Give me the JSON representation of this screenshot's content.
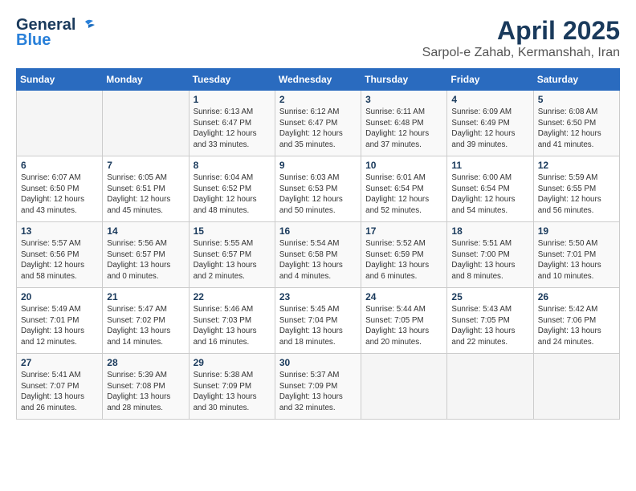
{
  "logo": {
    "general": "General",
    "blue": "Blue"
  },
  "title": {
    "month": "April 2025",
    "location": "Sarpol-e Zahab, Kermanshah, Iran"
  },
  "weekdays": [
    "Sunday",
    "Monday",
    "Tuesday",
    "Wednesday",
    "Thursday",
    "Friday",
    "Saturday"
  ],
  "weeks": [
    [
      {
        "day": "",
        "info": ""
      },
      {
        "day": "",
        "info": ""
      },
      {
        "day": "1",
        "info": "Sunrise: 6:13 AM\nSunset: 6:47 PM\nDaylight: 12 hours\nand 33 minutes."
      },
      {
        "day": "2",
        "info": "Sunrise: 6:12 AM\nSunset: 6:47 PM\nDaylight: 12 hours\nand 35 minutes."
      },
      {
        "day": "3",
        "info": "Sunrise: 6:11 AM\nSunset: 6:48 PM\nDaylight: 12 hours\nand 37 minutes."
      },
      {
        "day": "4",
        "info": "Sunrise: 6:09 AM\nSunset: 6:49 PM\nDaylight: 12 hours\nand 39 minutes."
      },
      {
        "day": "5",
        "info": "Sunrise: 6:08 AM\nSunset: 6:50 PM\nDaylight: 12 hours\nand 41 minutes."
      }
    ],
    [
      {
        "day": "6",
        "info": "Sunrise: 6:07 AM\nSunset: 6:50 PM\nDaylight: 12 hours\nand 43 minutes."
      },
      {
        "day": "7",
        "info": "Sunrise: 6:05 AM\nSunset: 6:51 PM\nDaylight: 12 hours\nand 45 minutes."
      },
      {
        "day": "8",
        "info": "Sunrise: 6:04 AM\nSunset: 6:52 PM\nDaylight: 12 hours\nand 48 minutes."
      },
      {
        "day": "9",
        "info": "Sunrise: 6:03 AM\nSunset: 6:53 PM\nDaylight: 12 hours\nand 50 minutes."
      },
      {
        "day": "10",
        "info": "Sunrise: 6:01 AM\nSunset: 6:54 PM\nDaylight: 12 hours\nand 52 minutes."
      },
      {
        "day": "11",
        "info": "Sunrise: 6:00 AM\nSunset: 6:54 PM\nDaylight: 12 hours\nand 54 minutes."
      },
      {
        "day": "12",
        "info": "Sunrise: 5:59 AM\nSunset: 6:55 PM\nDaylight: 12 hours\nand 56 minutes."
      }
    ],
    [
      {
        "day": "13",
        "info": "Sunrise: 5:57 AM\nSunset: 6:56 PM\nDaylight: 12 hours\nand 58 minutes."
      },
      {
        "day": "14",
        "info": "Sunrise: 5:56 AM\nSunset: 6:57 PM\nDaylight: 13 hours\nand 0 minutes."
      },
      {
        "day": "15",
        "info": "Sunrise: 5:55 AM\nSunset: 6:57 PM\nDaylight: 13 hours\nand 2 minutes."
      },
      {
        "day": "16",
        "info": "Sunrise: 5:54 AM\nSunset: 6:58 PM\nDaylight: 13 hours\nand 4 minutes."
      },
      {
        "day": "17",
        "info": "Sunrise: 5:52 AM\nSunset: 6:59 PM\nDaylight: 13 hours\nand 6 minutes."
      },
      {
        "day": "18",
        "info": "Sunrise: 5:51 AM\nSunset: 7:00 PM\nDaylight: 13 hours\nand 8 minutes."
      },
      {
        "day": "19",
        "info": "Sunrise: 5:50 AM\nSunset: 7:01 PM\nDaylight: 13 hours\nand 10 minutes."
      }
    ],
    [
      {
        "day": "20",
        "info": "Sunrise: 5:49 AM\nSunset: 7:01 PM\nDaylight: 13 hours\nand 12 minutes."
      },
      {
        "day": "21",
        "info": "Sunrise: 5:47 AM\nSunset: 7:02 PM\nDaylight: 13 hours\nand 14 minutes."
      },
      {
        "day": "22",
        "info": "Sunrise: 5:46 AM\nSunset: 7:03 PM\nDaylight: 13 hours\nand 16 minutes."
      },
      {
        "day": "23",
        "info": "Sunrise: 5:45 AM\nSunset: 7:04 PM\nDaylight: 13 hours\nand 18 minutes."
      },
      {
        "day": "24",
        "info": "Sunrise: 5:44 AM\nSunset: 7:05 PM\nDaylight: 13 hours\nand 20 minutes."
      },
      {
        "day": "25",
        "info": "Sunrise: 5:43 AM\nSunset: 7:05 PM\nDaylight: 13 hours\nand 22 minutes."
      },
      {
        "day": "26",
        "info": "Sunrise: 5:42 AM\nSunset: 7:06 PM\nDaylight: 13 hours\nand 24 minutes."
      }
    ],
    [
      {
        "day": "27",
        "info": "Sunrise: 5:41 AM\nSunset: 7:07 PM\nDaylight: 13 hours\nand 26 minutes."
      },
      {
        "day": "28",
        "info": "Sunrise: 5:39 AM\nSunset: 7:08 PM\nDaylight: 13 hours\nand 28 minutes."
      },
      {
        "day": "29",
        "info": "Sunrise: 5:38 AM\nSunset: 7:09 PM\nDaylight: 13 hours\nand 30 minutes."
      },
      {
        "day": "30",
        "info": "Sunrise: 5:37 AM\nSunset: 7:09 PM\nDaylight: 13 hours\nand 32 minutes."
      },
      {
        "day": "",
        "info": ""
      },
      {
        "day": "",
        "info": ""
      },
      {
        "day": "",
        "info": ""
      }
    ]
  ]
}
